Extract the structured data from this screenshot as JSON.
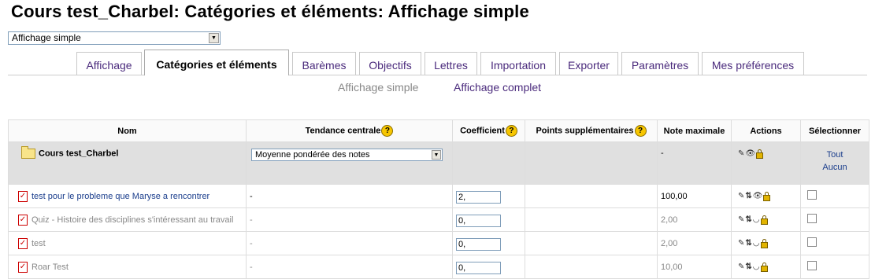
{
  "page": {
    "title": "Cours test_Charbel: Catégories et éléments: Affichage simple",
    "view_select": "Affichage simple"
  },
  "tabs": [
    {
      "label": "Affichage",
      "active": false
    },
    {
      "label": "Catégories et éléments",
      "active": true
    },
    {
      "label": "Barèmes",
      "active": false
    },
    {
      "label": "Objectifs",
      "active": false
    },
    {
      "label": "Lettres",
      "active": false
    },
    {
      "label": "Importation",
      "active": false
    },
    {
      "label": "Exporter",
      "active": false
    },
    {
      "label": "Paramètres",
      "active": false
    },
    {
      "label": "Mes préférences",
      "active": false
    }
  ],
  "subnav": {
    "current": "Affichage simple",
    "link": "Affichage complet"
  },
  "table": {
    "headers": {
      "name": "Nom",
      "central": "Tendance centrale",
      "coef": "Coefficient",
      "extra": "Points supplémentaires",
      "max": "Note maximale",
      "actions": "Actions",
      "select": "Sélectionner"
    },
    "category": {
      "name": "Cours test_Charbel",
      "aggregation": "Moyenne pondérée des notes",
      "max": "-",
      "select_all": "Tout",
      "select_none": "Aucun"
    },
    "rows": [
      {
        "name": "test pour le probleme que Maryse a rencontrer",
        "central": "-",
        "coef": "2,",
        "max": "100,00"
      },
      {
        "name": "Quiz - Histoire des disciplines s'intéressant au travail",
        "central": "-",
        "coef": "0,",
        "max": "2,00"
      },
      {
        "name": "test",
        "central": "-",
        "coef": "0,",
        "max": "2,00"
      },
      {
        "name": "Roar Test",
        "central": "-",
        "coef": "0,",
        "max": "10,00"
      }
    ]
  },
  "icons": {
    "help": "help-icon",
    "folder": "folder-icon",
    "item": "quiz-item-icon",
    "edit": "edit-icon",
    "move": "move-icon",
    "show": "eye-icon",
    "hide": "eye-closed-icon",
    "lock": "lock-icon"
  }
}
